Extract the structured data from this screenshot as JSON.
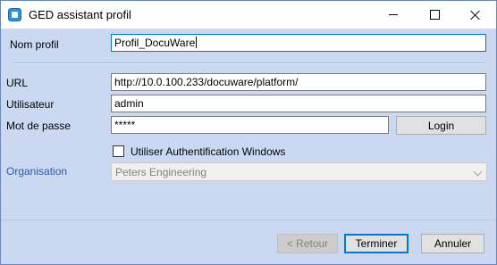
{
  "window": {
    "title": "GED assistant profil"
  },
  "form": {
    "profile_name_label": "Nom profil",
    "profile_name_value": "Profil_DocuWare",
    "url_label": "URL",
    "url_value": "http://10.0.100.233/docuware/platform/",
    "user_label": "Utilisateur",
    "user_value": "admin",
    "password_label": "Mot de passe",
    "password_value": "*****",
    "login_button": "Login",
    "windows_auth_label": "Utiliser Authentification Windows",
    "windows_auth_checked": false,
    "organisation_label": "Organisation",
    "organisation_value": "Peters Engineering"
  },
  "footer": {
    "back_button": "< Retour",
    "finish_button": "Terminer",
    "cancel_button": "Annuler"
  }
}
